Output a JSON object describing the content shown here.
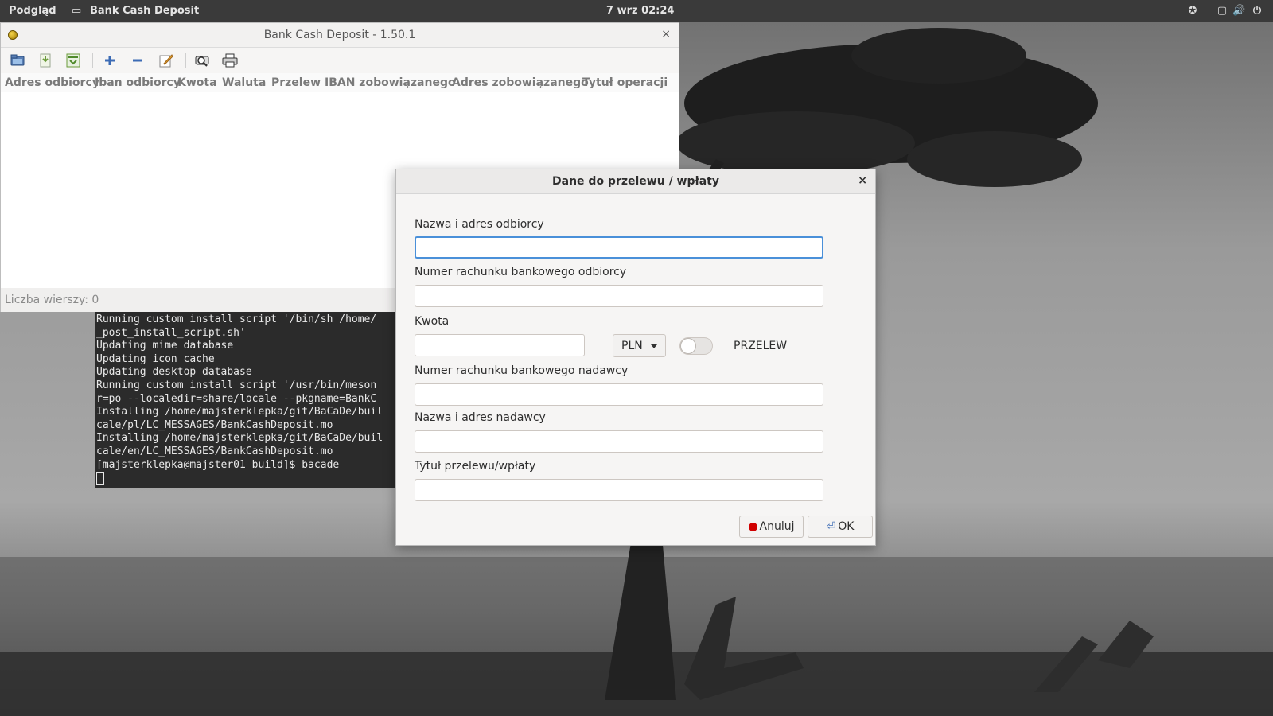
{
  "topbar": {
    "activities": "Podgląd",
    "app_name": "Bank Cash Deposit",
    "clock": "7 wrz  02:24",
    "tray_icons": [
      "accessibility-icon",
      "window-icon",
      "volume-icon",
      "power-icon"
    ]
  },
  "main_window": {
    "title": "Bank Cash Deposit - 1.50.1",
    "close": "×",
    "toolbar": [
      "open-icon",
      "save-icon",
      "export-icon",
      "add-icon",
      "remove-icon",
      "edit-icon",
      "preview-icon",
      "print-icon"
    ],
    "columns": [
      "Adres odbiorcy",
      "Iban odbiorcy",
      "Kwota",
      "Waluta",
      "Przelew",
      "IBAN zobowiązanego",
      "Adres zobowiązanego",
      "Tytuł operacji"
    ],
    "status": "Liczba wierszy: 0"
  },
  "terminal": {
    "lines": [
      "Running custom install script '/bin/sh /home/",
      "_post_install_script.sh'",
      "Updating mime database",
      "Updating icon cache",
      "Updating desktop database",
      "Running custom install script '/usr/bin/meson",
      "r=po --localedir=share/locale --pkgname=BankC",
      "Installing /home/majsterklepka/git/BaCaDe/buil",
      "cale/pl/LC_MESSAGES/BankCashDeposit.mo",
      "Installing /home/majsterklepka/git/BaCaDe/buil",
      "cale/en/LC_MESSAGES/BankCashDeposit.mo",
      "[majsterklepka@majster01 build]$ bacade"
    ]
  },
  "dialog": {
    "title": "Dane do przelewu / wpłaty",
    "close": "×",
    "recipient_label": "Nazwa i adres odbiorcy",
    "recipient_value": "",
    "recipient_account_label": "Numer rachunku bankowego odbiorcy",
    "recipient_account_value": "",
    "amount_label": "Kwota",
    "amount_value": "",
    "currency": "PLN",
    "transfer_toggle_on": false,
    "transfer_label": "PRZELEW",
    "sender_account_label": "Numer rachunku bankowego nadawcy",
    "sender_account_value": "",
    "sender_label": "Nazwa i adres nadawcy",
    "sender_value": "",
    "title_field_label": "Tytuł przelewu/wpłaty",
    "title_field_value": "",
    "cancel_label": "Anuluj",
    "ok_label": "OK",
    "cancel_color": "#d00000"
  }
}
